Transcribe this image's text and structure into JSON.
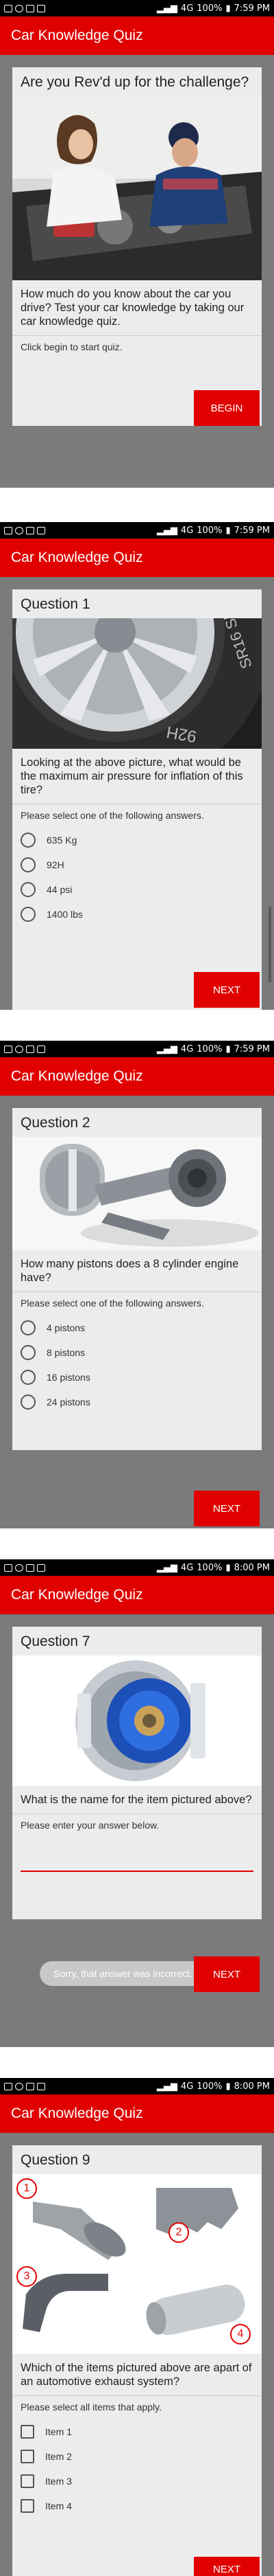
{
  "app_title": "Car Knowledge Quiz",
  "screens": [
    {
      "time": "7:59 PM",
      "battery": "100%",
      "network": "4G",
      "card_title": "Are you Rev'd up for the challenge?",
      "description": "How much do you know about the car you drive? Test your car knowledge by taking our car knowledge quiz.",
      "instruction": "Click begin to start quiz.",
      "button": "BEGIN"
    },
    {
      "time": "7:59 PM",
      "battery": "100%",
      "network": "4G",
      "card_title": "Question 1",
      "tire_text": "92H",
      "tire_text2": "SR16 SL",
      "question": "Looking at the above picture, what would be the maximum air pressure for inflation of this tire?",
      "instruction": "Please select one of the following answers.",
      "options": [
        "635 Kg",
        "92H",
        "44 psi",
        "1400 lbs"
      ],
      "button": "NEXT"
    },
    {
      "time": "7:59 PM",
      "battery": "100%",
      "network": "4G",
      "card_title": "Question 2",
      "question": "How many pistons does a 8 cylinder engine have?",
      "instruction": "Please select one of the following answers.",
      "options": [
        "4 pistons",
        "8 pistons",
        "16 pistons",
        "24 pistons"
      ],
      "button": "NEXT"
    },
    {
      "time": "8:00 PM",
      "battery": "100%",
      "network": "4G",
      "card_title": "Question 7",
      "question": "What is the name for the item pictured above?",
      "instruction": "Please enter your answer below.",
      "answer_value": "",
      "toast": "Sorry, that answer was incorrect.",
      "button": "NEXT"
    },
    {
      "time": "8:00 PM",
      "battery": "100%",
      "network": "4G",
      "card_title": "Question 9",
      "item_numbers": [
        "1",
        "2",
        "3",
        "4"
      ],
      "question": "Which of the items pictured above are apart of an automotive exhaust system?",
      "instruction": "Please select all items that apply.",
      "options": [
        "Item 1",
        "Item 2",
        "Item 3",
        "Item 4"
      ],
      "button": "NEXT"
    }
  ]
}
